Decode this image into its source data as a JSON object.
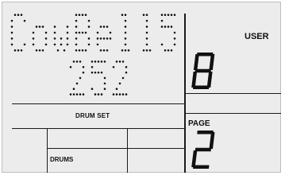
{
  "display": {
    "voice_name": "CowBell5",
    "voice_number": "252",
    "user_label": "USER",
    "user_digit": "8",
    "drumset_label": "DRUM SET",
    "drums_label": "DRUMS",
    "page_label": "PAGE",
    "page_digit": "2"
  },
  "colors": {
    "lcd_background": "#ececec",
    "segment": "#111111"
  }
}
